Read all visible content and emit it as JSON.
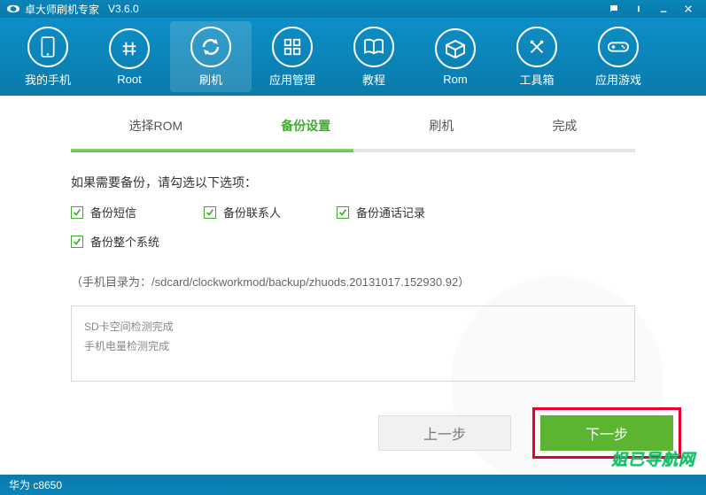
{
  "app": {
    "title": "卓大师刷机专家",
    "version": "V3.6.0"
  },
  "toolbar": {
    "items": [
      {
        "label": "我的手机"
      },
      {
        "label": "Root"
      },
      {
        "label": "刷机"
      },
      {
        "label": "应用管理"
      },
      {
        "label": "教程"
      },
      {
        "label": "Rom"
      },
      {
        "label": "工具箱"
      },
      {
        "label": "应用游戏"
      }
    ]
  },
  "steps": {
    "items": [
      {
        "label": "选择ROM"
      },
      {
        "label": "备份设置"
      },
      {
        "label": "刷机"
      },
      {
        "label": "完成"
      }
    ]
  },
  "backup": {
    "instruction": "如果需要备份，请勾选以下选项：",
    "options": {
      "sms": "备份短信",
      "contacts": "备份联系人",
      "calllog": "备份通话记录",
      "system": "备份整个系统"
    },
    "path_note": "（手机目录为：/sdcard/clockworkmod/backup/zhuods.20131017.152930.92）"
  },
  "log": {
    "line1": "SD卡空间检测完成",
    "line2": "手机电量检测完成"
  },
  "buttons": {
    "prev": "上一步",
    "next": "下一步"
  },
  "status": {
    "device": "华为 c8650"
  },
  "watermark": "姐已导航网"
}
